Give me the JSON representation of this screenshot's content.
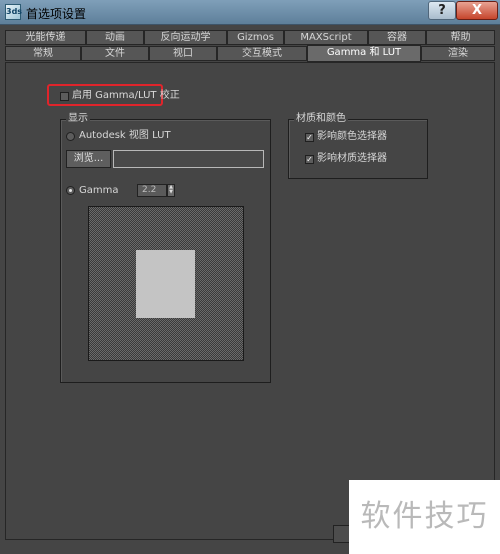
{
  "window": {
    "title": "首选项设置",
    "icon_label": "3ds",
    "help_label": "?",
    "close_label": "X"
  },
  "tabs_row1": [
    "光能传递",
    "动画",
    "反向运动学",
    "Gizmos",
    "MAXScript",
    "容器",
    "帮助"
  ],
  "tabs_row2": [
    "常规",
    "文件",
    "视口",
    "交互模式",
    "Gamma 和 LUT",
    "渲染"
  ],
  "active_tab": "Gamma 和 LUT",
  "gamma_lut": {
    "enable_label": "启用 Gamma/LUT 校正",
    "enable_checked": false
  },
  "display_group": {
    "title": "显示",
    "autodesk_lut_label": "Autodesk 视图 LUT",
    "autodesk_lut_selected": false,
    "browse_label": "浏览...",
    "path_value": "",
    "gamma_label": "Gamma",
    "gamma_selected": true,
    "gamma_value": "2.2"
  },
  "materials_group": {
    "title": "材质和颜色",
    "affect_color_selector_label": "影响颜色选择器",
    "affect_color_selector_checked": true,
    "affect_material_selector_label": "影响材质选择器",
    "affect_material_selector_checked": true
  },
  "watermark": "软件技巧",
  "colors": {
    "highlight": "#e0242b",
    "panel_bg": "#454545",
    "title_bar": "#7f9fb9"
  }
}
